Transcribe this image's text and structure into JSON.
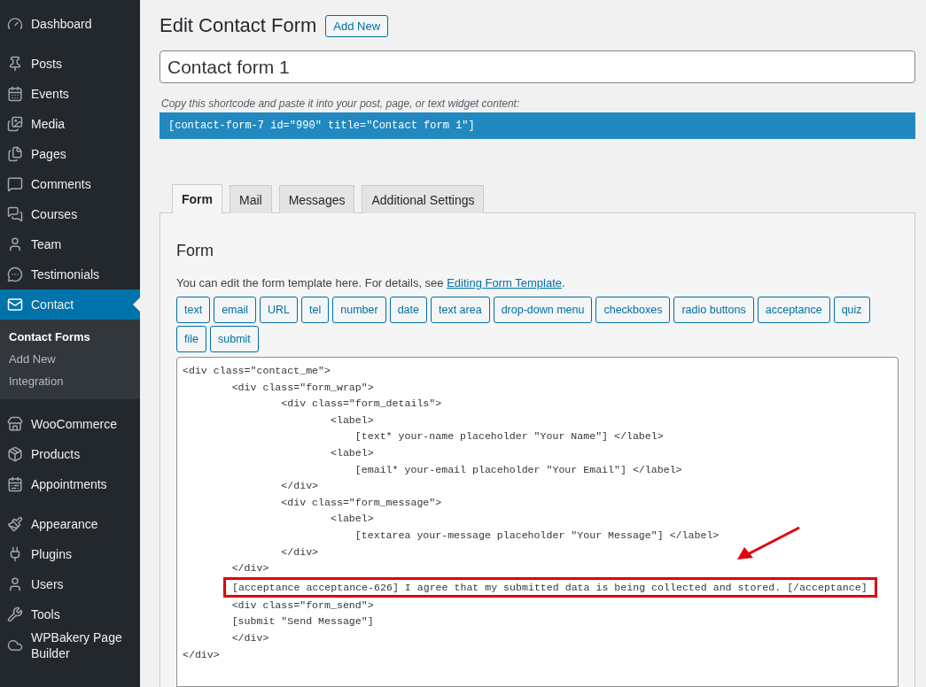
{
  "sidebar": {
    "groups": [
      [
        {
          "label": "Dashboard",
          "selected": false
        }
      ],
      [
        {
          "label": "Posts",
          "selected": false
        },
        {
          "label": "Events",
          "selected": false
        },
        {
          "label": "Media",
          "selected": false
        },
        {
          "label": "Pages",
          "selected": false
        },
        {
          "label": "Comments",
          "selected": false
        },
        {
          "label": "Courses",
          "selected": false
        },
        {
          "label": "Team",
          "selected": false
        },
        {
          "label": "Testimonials",
          "selected": false
        },
        {
          "label": "Contact",
          "selected": true,
          "children": [
            {
              "label": "Contact Forms",
              "selected": true
            },
            {
              "label": "Add New",
              "selected": false
            },
            {
              "label": "Integration",
              "selected": false
            }
          ]
        }
      ],
      [
        {
          "label": "WooCommerce",
          "selected": false
        },
        {
          "label": "Products",
          "selected": false
        },
        {
          "label": "Appointments",
          "selected": false
        }
      ],
      [
        {
          "label": "Appearance",
          "selected": false
        },
        {
          "label": "Plugins",
          "selected": false
        },
        {
          "label": "Users",
          "selected": false
        },
        {
          "label": "Tools",
          "selected": false
        },
        {
          "label": "WPBakery Page Builder",
          "selected": false
        }
      ]
    ]
  },
  "header": {
    "title": "Edit Contact Form",
    "add_new": "Add New"
  },
  "form_title": {
    "value": "Contact form 1"
  },
  "shortcode": {
    "hint": "Copy this shortcode and paste it into your post, page, or text widget content:",
    "code": "[contact-form-7 id=\"990\" title=\"Contact form 1\"]"
  },
  "tabs": [
    {
      "label": "Form",
      "selected": true
    },
    {
      "label": "Mail",
      "selected": false
    },
    {
      "label": "Messages",
      "selected": false
    },
    {
      "label": "Additional Settings",
      "selected": false
    }
  ],
  "panel": {
    "heading": "Form",
    "intro": "You can edit the form template here. For details, see ",
    "link": "Editing Form Template",
    "intro_end": ".",
    "tag_buttons": [
      "text",
      "email",
      "URL",
      "tel",
      "number",
      "date",
      "text area",
      "drop-down menu",
      "checkboxes",
      "radio buttons",
      "acceptance",
      "quiz",
      "file",
      "submit"
    ],
    "code_lines": [
      {
        "text": "<div class=\"contact_me\">",
        "highlighted": false
      },
      {
        "text": "        <div class=\"form_wrap\">",
        "highlighted": false
      },
      {
        "text": "                <div class=\"form_details\">",
        "highlighted": false
      },
      {
        "text": "                        <label>",
        "highlighted": false
      },
      {
        "text": "                            [text* your-name placeholder \"Your Name\"] </label>",
        "highlighted": false
      },
      {
        "text": "                        <label>",
        "highlighted": false
      },
      {
        "text": "                            [email* your-email placeholder \"Your Email\"] </label>",
        "highlighted": false
      },
      {
        "text": "                </div>",
        "highlighted": false
      },
      {
        "text": "                <div class=\"form_message\">",
        "highlighted": false
      },
      {
        "text": "                        <label>",
        "highlighted": false
      },
      {
        "text": "                            [textarea your-message placeholder \"Your Message\"] </label>",
        "highlighted": false
      },
      {
        "text": "                </div>",
        "highlighted": false
      },
      {
        "text": "        </div>",
        "highlighted": false
      },
      {
        "text": "[acceptance acceptance-626] I agree that my submitted data is being collected and stored. [/acceptance]",
        "highlighted": true
      },
      {
        "text": "        <div class=\"form_send\">",
        "highlighted": false
      },
      {
        "text": "        [submit \"Send Message\"]",
        "highlighted": false
      },
      {
        "text": "        </div>",
        "highlighted": false
      },
      {
        "text": "</div>",
        "highlighted": false
      }
    ]
  }
}
